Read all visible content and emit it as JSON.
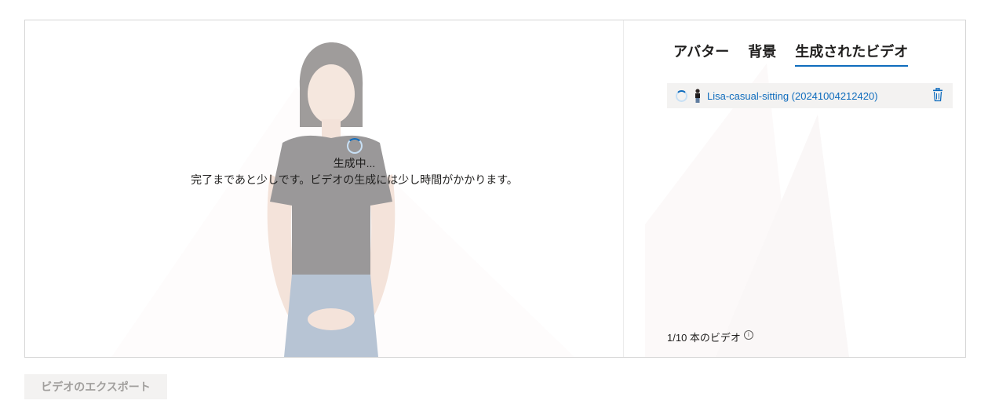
{
  "preview": {
    "status_title": "生成中...",
    "status_message": "完了まであと少しです。ビデオの生成には少し時間がかかります。"
  },
  "panel": {
    "tabs": [
      {
        "label": "アバター",
        "active": false
      },
      {
        "label": "背景",
        "active": false
      },
      {
        "label": "生成されたビデオ",
        "active": true
      }
    ],
    "videos": [
      {
        "name": "Lisa-casual-sitting (20241004212420)",
        "status": "generating"
      }
    ],
    "count_label": "1/10 本のビデオ",
    "info_icon": "info-icon"
  },
  "export_button": {
    "label": "ビデオのエクスポート",
    "disabled": true
  },
  "colors": {
    "accent": "#0f6cbd",
    "row_bg": "#f3f2f1",
    "border": "#d6d6d6"
  }
}
